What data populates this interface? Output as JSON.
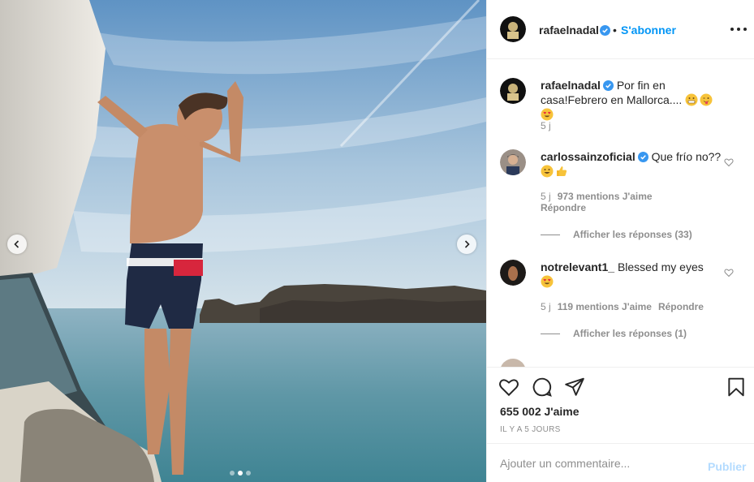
{
  "post": {
    "author": "rafaelnadal",
    "follow_label": "S'abonner",
    "separator": "•",
    "carousel": {
      "slides": 3,
      "active_slide": 2
    }
  },
  "caption": {
    "username": "rafaelnadal",
    "text": "Por fin en casa!Febrero en Mallorca....",
    "emojis": [
      "grimacing-face-emoji",
      "winking-tongue-face-emoji",
      "heart-eyes-face-emoji"
    ],
    "time": "5 j"
  },
  "comments": [
    {
      "username": "carlossainzoficial",
      "verified": true,
      "text": "Que frío no??",
      "emojis": [
        "grinning-face-emoji",
        "thumbs-up-emoji"
      ],
      "time": "5 j",
      "likes": "973 mentions J'aime",
      "reply_label": "Répondre",
      "view_replies": "Afficher les réponses (33)"
    },
    {
      "username": "notrelevant1_",
      "verified": false,
      "text": "Blessed my eyes",
      "emojis": [
        "heart-eyes-face-emoji"
      ],
      "time": "5 j",
      "likes": "119 mentions J'aime",
      "reply_label": "Répondre",
      "view_replies": "Afficher les réponses (1)"
    }
  ],
  "engagement": {
    "likes": "655 002 J'aime",
    "date": "IL Y A 5 JOURS"
  },
  "add_comment": {
    "placeholder": "Ajouter un commentaire...",
    "publish_label": "Publier"
  },
  "colors": {
    "accent_blue": "#0095f6",
    "publish_disabled": "#b3dbff",
    "muted_text": "#8e8e8e",
    "text": "#262626",
    "verified_blue": "#3897f0"
  }
}
